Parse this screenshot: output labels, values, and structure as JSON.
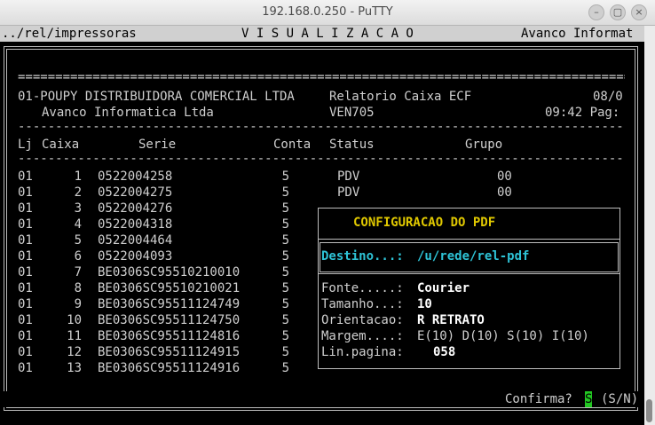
{
  "window": {
    "title": "192.168.0.250 - PuTTY",
    "min_icon": "minimize-icon",
    "max_icon": "maximize-icon",
    "close_icon": "close-icon"
  },
  "header": {
    "path": "../rel/impressoras",
    "screen": "V I S U A L I Z A C A O",
    "company": "Avanco Informat"
  },
  "report": {
    "separator": "=====================================================================================",
    "line1_company": "01-POUPY DISTRIBUIDORA COMERCIAL LTDA",
    "line1_title": "Relatorio Caixa ECF",
    "line1_date": "08/0",
    "line2_company": "Avanco Informatica Ltda",
    "line2_program": "VEN705",
    "line2_time": "09:42 Pag:",
    "dash": "-------------------------------------------------------------------------------------",
    "columns": {
      "lj": "Lj",
      "caixa": "Caixa",
      "serie": "Serie",
      "conta": "Conta",
      "status": "Status",
      "grupo": "Grupo"
    },
    "rows": [
      {
        "lj": "01",
        "caixa": "1",
        "serie": "0522004258",
        "conta": "5",
        "status": "PDV",
        "grupo": "00"
      },
      {
        "lj": "01",
        "caixa": "2",
        "serie": "0522004275",
        "conta": "5",
        "status": "PDV",
        "grupo": "00"
      },
      {
        "lj": "01",
        "caixa": "3",
        "serie": "0522004276",
        "conta": "5",
        "status": "",
        "grupo": ""
      },
      {
        "lj": "01",
        "caixa": "4",
        "serie": "0522004318",
        "conta": "5",
        "status": "",
        "grupo": ""
      },
      {
        "lj": "01",
        "caixa": "5",
        "serie": "0522004464",
        "conta": "5",
        "status": "",
        "grupo": ""
      },
      {
        "lj": "01",
        "caixa": "6",
        "serie": "0522004093",
        "conta": "5",
        "status": "",
        "grupo": ""
      },
      {
        "lj": "01",
        "caixa": "7",
        "serie": "BE0306SC95510210010",
        "conta": "5",
        "status": "",
        "grupo": ""
      },
      {
        "lj": "01",
        "caixa": "8",
        "serie": "BE0306SC95510210021",
        "conta": "5",
        "status": "",
        "grupo": ""
      },
      {
        "lj": "01",
        "caixa": "9",
        "serie": "BE0306SC95511124749",
        "conta": "5",
        "status": "",
        "grupo": ""
      },
      {
        "lj": "01",
        "caixa": "10",
        "serie": "BE0306SC95511124750",
        "conta": "5",
        "status": "",
        "grupo": ""
      },
      {
        "lj": "01",
        "caixa": "11",
        "serie": "BE0306SC95511124816",
        "conta": "5",
        "status": "",
        "grupo": ""
      },
      {
        "lj": "01",
        "caixa": "12",
        "serie": "BE0306SC95511124915",
        "conta": "5",
        "status": "",
        "grupo": ""
      },
      {
        "lj": "01",
        "caixa": "13",
        "serie": "BE0306SC95511124916",
        "conta": "5",
        "status": "",
        "grupo": ""
      }
    ]
  },
  "dialog": {
    "title": "CONFIGURACAO DO PDF",
    "destino_label": "Destino...:",
    "destino_value": "/u/rede/rel-pdf",
    "fonte_label": "Fonte.....:",
    "fonte_value": "Courier",
    "tamanho_label": "Tamanho...:",
    "tamanho_value": "10",
    "orientacao_label": "Orientacao:",
    "orientacao_value": "R RETRATO",
    "margem_label": "Margem....:",
    "margem_value": "E(10) D(10) S(10) I(10)",
    "linpag_label": "Lin.pagina:",
    "linpag_value": "058"
  },
  "prompt": {
    "text": "Confirma?",
    "answer": "S",
    "options": "(S/N)"
  },
  "colors": {
    "terminal_bg": "#000000",
    "text": "#cfcfcf",
    "yellow": "#e0c800",
    "cyan": "#2ec3d6",
    "cursor": "#22c722"
  }
}
